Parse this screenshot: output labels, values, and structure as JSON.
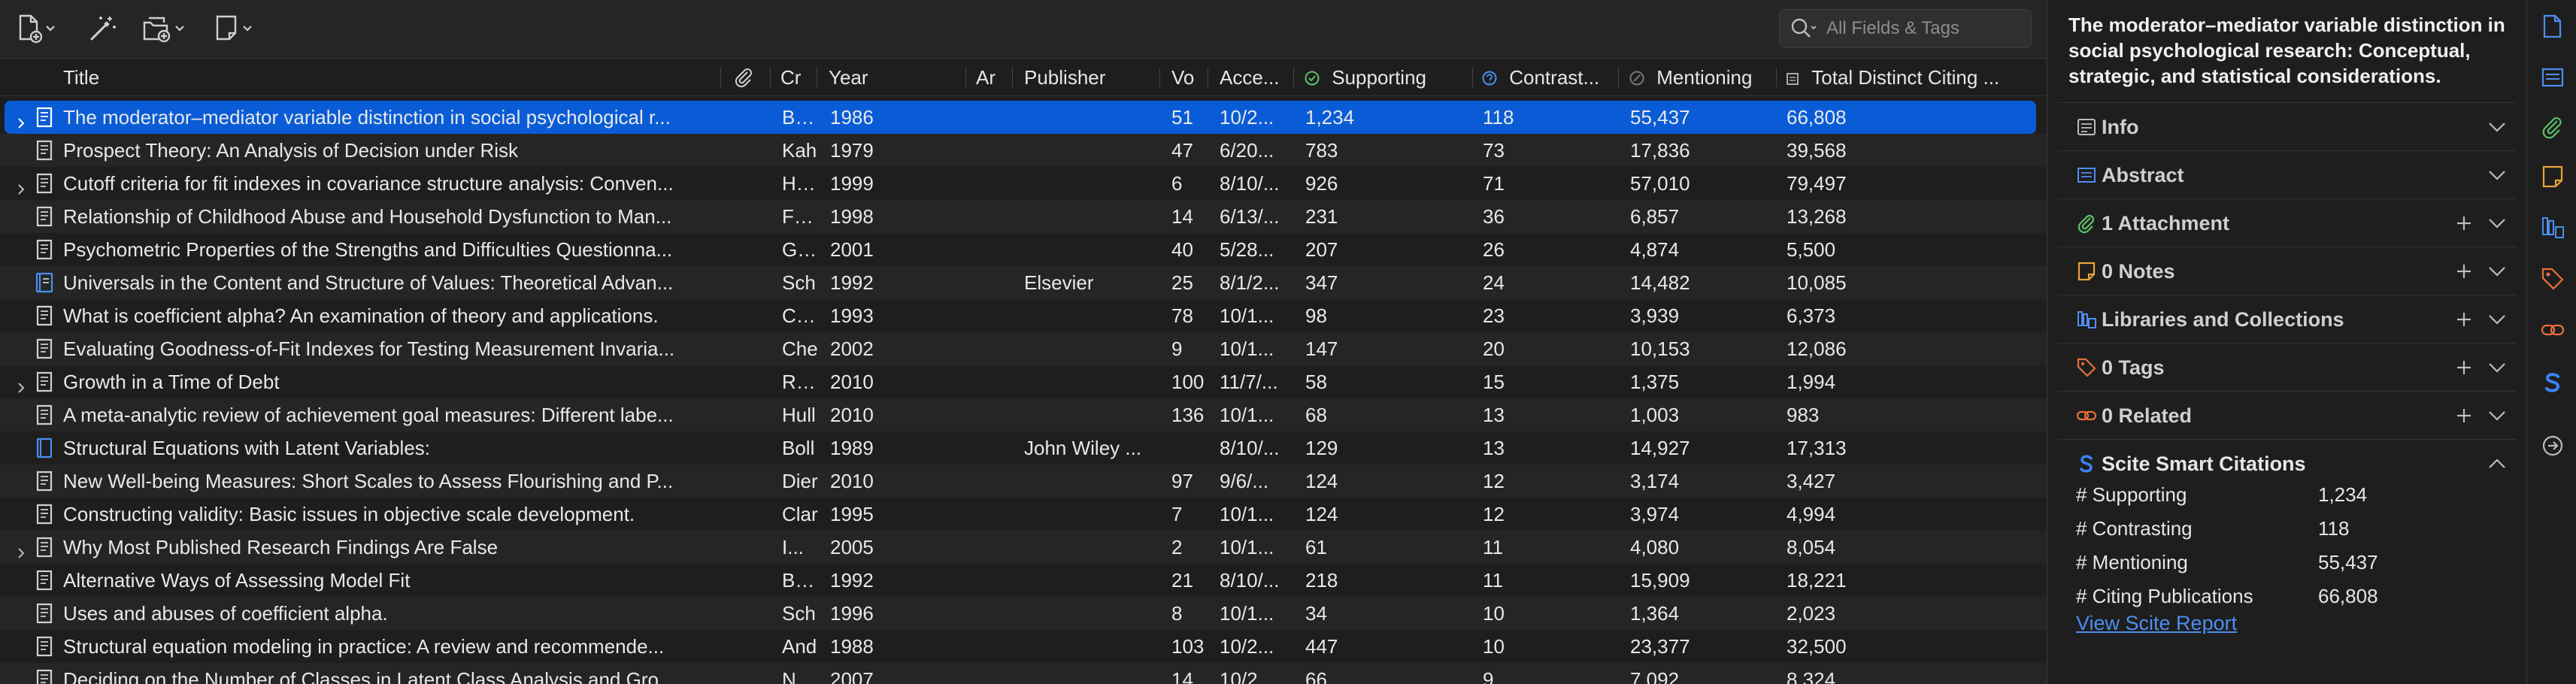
{
  "search": {
    "placeholder": "All Fields & Tags"
  },
  "columns": [
    {
      "id": "title",
      "label": "Title"
    },
    {
      "id": "attachments",
      "label": ""
    },
    {
      "id": "creator",
      "label": "Cr"
    },
    {
      "id": "year",
      "label": "Year"
    },
    {
      "id": "archive",
      "label": "Ar"
    },
    {
      "id": "publisher",
      "label": "Publisher"
    },
    {
      "id": "volume",
      "label": "Vo"
    },
    {
      "id": "accessed",
      "label": "Acce..."
    },
    {
      "id": "supporting",
      "label": "Supporting"
    },
    {
      "id": "contrasting",
      "label": "Contrast..."
    },
    {
      "id": "mentioning",
      "label": "Mentioning"
    },
    {
      "id": "total",
      "label": "Total Distinct Citing ..."
    }
  ],
  "rows": [
    {
      "twisty": true,
      "icon": "document",
      "title": "The moderator–mediator variable distinction in social psychological r...",
      "creator": "Baro",
      "year": "1986",
      "publisher": "",
      "volume": "51",
      "accessed": "10/2...",
      "supporting": "1,234",
      "contrasting": "118",
      "mentioning": "55,437",
      "total": "66,808",
      "selected": true
    },
    {
      "twisty": false,
      "icon": "document",
      "title": "Prospect Theory: An Analysis of Decision under Risk",
      "creator": "Kah",
      "year": "1979",
      "publisher": "",
      "volume": "47",
      "accessed": "6/20...",
      "supporting": "783",
      "contrasting": "73",
      "mentioning": "17,836",
      "total": "39,568"
    },
    {
      "twisty": true,
      "icon": "document",
      "title": "Cutoff criteria for fit indexes in covariance structure analysis: Conven...",
      "creator": "Hu a",
      "year": "1999",
      "publisher": "",
      "volume": "6",
      "accessed": "8/10/...",
      "supporting": "926",
      "contrasting": "71",
      "mentioning": "57,010",
      "total": "79,497"
    },
    {
      "twisty": false,
      "icon": "document",
      "title": "Relationship of Childhood Abuse and Household Dysfunction to Man...",
      "creator": "Felit",
      "year": "1998",
      "publisher": "",
      "volume": "14",
      "accessed": "6/13/...",
      "supporting": "231",
      "contrasting": "36",
      "mentioning": "6,857",
      "total": "13,268"
    },
    {
      "twisty": false,
      "icon": "document",
      "title": "Psychometric Properties of the Strengths and Difficulties Questionna...",
      "creator": "Goo",
      "year": "2001",
      "publisher": "",
      "volume": "40",
      "accessed": "5/28...",
      "supporting": "207",
      "contrasting": "26",
      "mentioning": "4,874",
      "total": "5,500"
    },
    {
      "twisty": false,
      "icon": "book-section",
      "title": "Universals in the Content and Structure of Values: Theoretical Advan...",
      "creator": "Sch",
      "year": "1992",
      "publisher": "Elsevier",
      "volume": "25",
      "accessed": "8/1/2...",
      "supporting": "347",
      "contrasting": "24",
      "mentioning": "14,482",
      "total": "10,085"
    },
    {
      "twisty": false,
      "icon": "document",
      "title": "What is coefficient alpha? An examination of theory and applications.",
      "creator": "Cort",
      "year": "1993",
      "publisher": "",
      "volume": "78",
      "accessed": "10/1...",
      "supporting": "98",
      "contrasting": "23",
      "mentioning": "3,939",
      "total": "6,373"
    },
    {
      "twisty": false,
      "icon": "document",
      "title": "Evaluating Goodness-of-Fit Indexes for Testing Measurement Invaria...",
      "creator": "Che",
      "year": "2002",
      "publisher": "",
      "volume": "9",
      "accessed": "10/1...",
      "supporting": "147",
      "contrasting": "20",
      "mentioning": "10,153",
      "total": "12,086"
    },
    {
      "twisty": true,
      "icon": "document",
      "title": "Growth in a Time of Debt",
      "creator": "Rein",
      "year": "2010",
      "publisher": "",
      "volume": "100",
      "accessed": "11/7/...",
      "supporting": "58",
      "contrasting": "15",
      "mentioning": "1,375",
      "total": "1,994"
    },
    {
      "twisty": false,
      "icon": "document",
      "title": "A meta-analytic review of achievement goal measures: Different labe...",
      "creator": "Hull",
      "year": "2010",
      "publisher": "",
      "volume": "136",
      "accessed": "10/1...",
      "supporting": "68",
      "contrasting": "13",
      "mentioning": "1,003",
      "total": "983"
    },
    {
      "twisty": false,
      "icon": "book",
      "title": "Structural Equations with Latent Variables:",
      "creator": "Boll",
      "year": "1989",
      "publisher": "John Wiley ...",
      "volume": "",
      "accessed": "8/10/...",
      "supporting": "129",
      "contrasting": "13",
      "mentioning": "14,927",
      "total": "17,313"
    },
    {
      "twisty": false,
      "icon": "document",
      "title": "New Well-being Measures: Short Scales to Assess Flourishing and P...",
      "creator": "Dier",
      "year": "2010",
      "publisher": "",
      "volume": "97",
      "accessed": "9/6/...",
      "supporting": "124",
      "contrasting": "12",
      "mentioning": "3,174",
      "total": "3,427"
    },
    {
      "twisty": false,
      "icon": "document",
      "title": "Constructing validity: Basic issues in objective scale development.",
      "creator": "Clar",
      "year": "1995",
      "publisher": "",
      "volume": "7",
      "accessed": "10/1...",
      "supporting": "124",
      "contrasting": "12",
      "mentioning": "3,974",
      "total": "4,994"
    },
    {
      "twisty": true,
      "icon": "document",
      "title": "Why Most Published Research Findings Are False",
      "creator": "I...",
      "year": "2005",
      "publisher": "",
      "volume": "2",
      "accessed": "10/1...",
      "supporting": "61",
      "contrasting": "11",
      "mentioning": "4,080",
      "total": "8,054"
    },
    {
      "twisty": false,
      "icon": "document",
      "title": "Alternative Ways of Assessing Model Fit",
      "creator": "Brov",
      "year": "1992",
      "publisher": "",
      "volume": "21",
      "accessed": "8/10/...",
      "supporting": "218",
      "contrasting": "11",
      "mentioning": "15,909",
      "total": "18,221"
    },
    {
      "twisty": false,
      "icon": "document",
      "title": "Uses and abuses of coefficient alpha.",
      "creator": "Sch",
      "year": "1996",
      "publisher": "",
      "volume": "8",
      "accessed": "10/1...",
      "supporting": "34",
      "contrasting": "10",
      "mentioning": "1,364",
      "total": "2,023"
    },
    {
      "twisty": false,
      "icon": "document",
      "title": "Structural equation modeling in practice: A review and recommende...",
      "creator": "And",
      "year": "1988",
      "publisher": "",
      "volume": "103",
      "accessed": "10/2...",
      "supporting": "447",
      "contrasting": "10",
      "mentioning": "23,377",
      "total": "32,500"
    },
    {
      "twisty": false,
      "icon": "document",
      "title": "Deciding on the Number of Classes in Latent Class Analysis and Gro...",
      "creator": "Nylu",
      "year": "2007",
      "publisher": "",
      "volume": "14",
      "accessed": "10/2...",
      "supporting": "66",
      "contrasting": "9",
      "mentioning": "7,092",
      "total": "8,324"
    }
  ],
  "item": {
    "title": "The moderator–mediator variable distinction in social psychological research: Conceptual, strategic, and statistical considerations."
  },
  "sections": [
    {
      "id": "info",
      "label": "Info",
      "icon": "info-icon",
      "color": "#bdbdbd",
      "plus": false,
      "chevron": "down"
    },
    {
      "id": "abstract",
      "label": "Abstract",
      "icon": "abstract-icon",
      "color": "#4c8ef0",
      "plus": false,
      "chevron": "down"
    },
    {
      "id": "attachments",
      "label": "1 Attachment",
      "icon": "paperclip-icon",
      "color": "#5cc26a",
      "plus": true,
      "chevron": "down"
    },
    {
      "id": "notes",
      "label": "0 Notes",
      "icon": "note-icon",
      "color": "#e8a33a",
      "plus": true,
      "chevron": "down"
    },
    {
      "id": "libraries",
      "label": "Libraries and Collections",
      "icon": "libraries-icon",
      "color": "#4c8ef0",
      "plus": true,
      "chevron": "down"
    },
    {
      "id": "tags",
      "label": "0 Tags",
      "icon": "tag-icon",
      "color": "#e8703a",
      "plus": true,
      "chevron": "down"
    },
    {
      "id": "related",
      "label": "0 Related",
      "icon": "related-icon",
      "color": "#e8703a",
      "plus": true,
      "chevron": "down"
    },
    {
      "id": "scite",
      "label": "Scite Smart Citations",
      "icon": "scite-icon",
      "color": "#3b82f6",
      "plus": false,
      "chevron": "up"
    }
  ],
  "scite": {
    "rows": [
      {
        "label": "# Supporting",
        "value": "1,234"
      },
      {
        "label": "# Contrasting",
        "value": "118"
      },
      {
        "label": "# Mentioning",
        "value": "55,437"
      },
      {
        "label": "# Citing Publications",
        "value": "66,808"
      }
    ],
    "link": "View Scite Report"
  },
  "colors": {
    "selected": "#0a5cd6",
    "link": "#4c8ef0",
    "accent": "#3b82f6"
  }
}
